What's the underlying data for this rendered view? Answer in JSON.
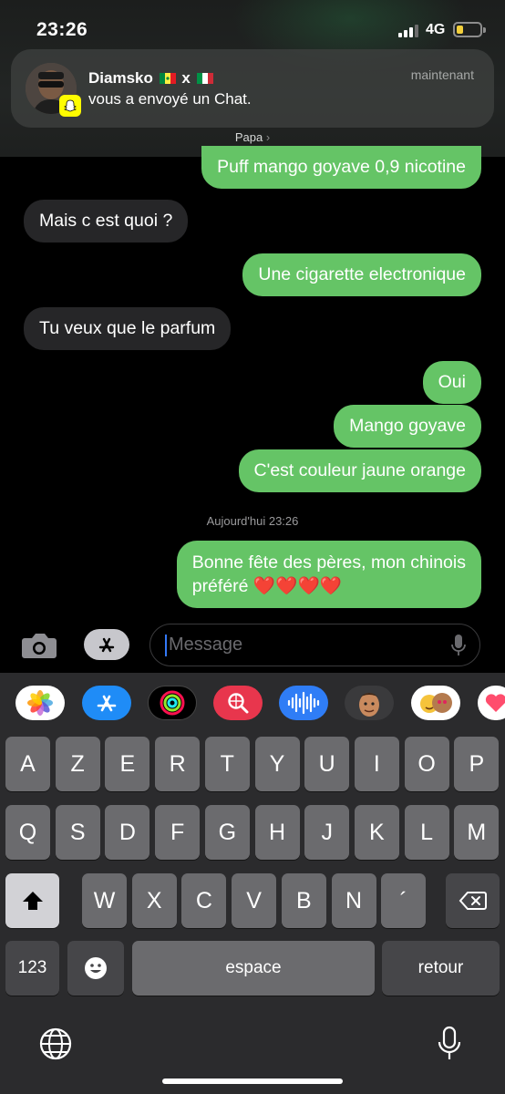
{
  "status": {
    "time": "23:26",
    "network": "4G"
  },
  "notification": {
    "sender": "Diamsko",
    "separator": "x",
    "body": "vous a envoyé un Chat.",
    "time": "maintenant",
    "app_badge": "snapchat-ghost-icon"
  },
  "conversation": {
    "contact": "Papa",
    "messages": [
      {
        "from": "me",
        "text": "Puff mango goyave 0,9 nicotine"
      },
      {
        "from": "them",
        "text": "Mais c est quoi ?"
      },
      {
        "from": "me",
        "text": "Une cigarette electronique"
      },
      {
        "from": "them",
        "text": "Tu veux que le parfum"
      },
      {
        "from": "me",
        "text": "Oui"
      },
      {
        "from": "me",
        "text": "Mango goyave"
      },
      {
        "from": "me",
        "text": "C'est couleur jaune orange"
      },
      {
        "from": "me",
        "text": "Bonne fête des pères, mon chinois",
        "text2": "préféré ❤️❤️❤️❤️"
      }
    ],
    "timestamp": "Aujourd'hui 23:26"
  },
  "input": {
    "placeholder": "Message"
  },
  "app_drawer": [
    "photos-icon",
    "app-store-icon",
    "activity-icon",
    "web-search-icon",
    "audio-message-icon",
    "memoji-icon",
    "animoji-icon",
    "stickers-icon"
  ],
  "keyboard": {
    "row1": [
      "A",
      "Z",
      "E",
      "R",
      "T",
      "Y",
      "U",
      "I",
      "O",
      "P"
    ],
    "row2": [
      "Q",
      "S",
      "D",
      "F",
      "G",
      "H",
      "J",
      "K",
      "L",
      "M"
    ],
    "row3": [
      "W",
      "X",
      "C",
      "V",
      "B",
      "N",
      "´"
    ],
    "numbers_label": "123",
    "space_label": "espace",
    "return_label": "retour"
  },
  "colors": {
    "sent": "#65c466",
    "received": "#262628",
    "caret": "#3478f6"
  }
}
